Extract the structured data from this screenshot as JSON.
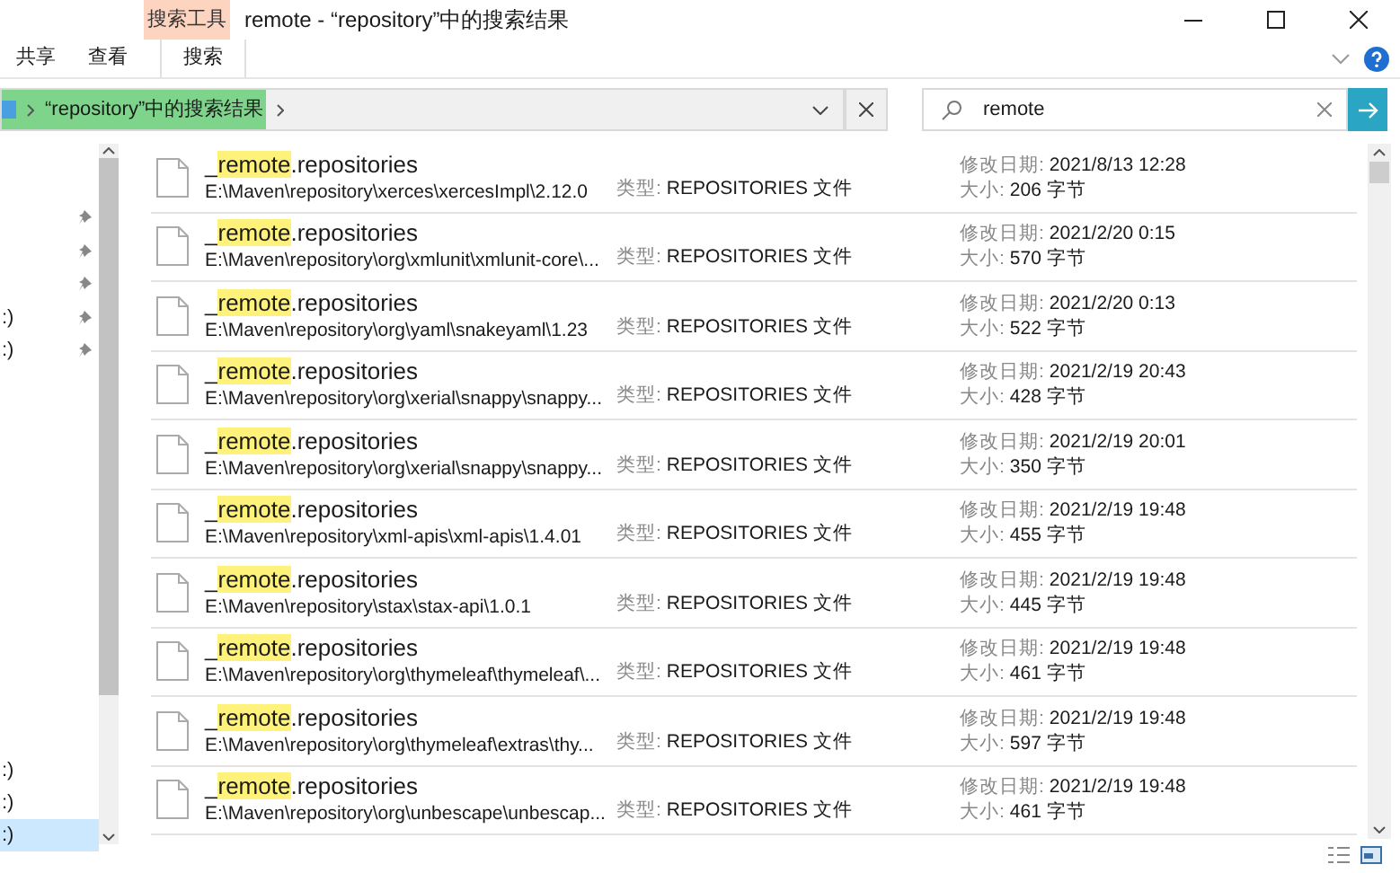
{
  "window": {
    "title": "remote - “repository”中的搜索结果"
  },
  "ribbon": {
    "context_label": "搜索工具",
    "tabs": [
      {
        "label": "共享",
        "selected": false
      },
      {
        "label": "查看",
        "selected": false
      },
      {
        "label": "搜索",
        "selected": true
      }
    ]
  },
  "address_bar": {
    "breadcrumb": "“repository”中的搜索结果"
  },
  "search": {
    "value": "remote"
  },
  "sidebar": {
    "items": [
      {
        "pinned": true,
        "selected": false
      },
      {
        "pinned": true,
        "selected": false
      },
      {
        "pinned": true,
        "selected": false
      },
      {
        "label": ":)",
        "pinned": true,
        "selected": false
      },
      {
        "label": ":)",
        "pinned": true,
        "selected": false
      },
      {
        "label": ":)",
        "pinned": false,
        "selected": false
      },
      {
        "label": ":)",
        "pinned": false,
        "selected": false
      },
      {
        "label": ":)",
        "pinned": false,
        "selected": true
      }
    ]
  },
  "results": [
    {
      "name_before": "_",
      "name_match": "remote",
      "name_after": ".repositories",
      "path": "E:\\Maven\\repository\\xerces\\xercesImpl\\2.12.0",
      "type_label": "类型:",
      "type": "REPOSITORIES 文件",
      "date_label": "修改日期:",
      "date": "2021/8/13 12:28",
      "size_label": "大小:",
      "size": "206 字节"
    },
    {
      "name_before": "_",
      "name_match": "remote",
      "name_after": ".repositories",
      "path": "E:\\Maven\\repository\\org\\xmlunit\\xmlunit-core\\...",
      "type_label": "类型:",
      "type": "REPOSITORIES 文件",
      "date_label": "修改日期:",
      "date": "2021/2/20 0:15",
      "size_label": "大小:",
      "size": "570 字节"
    },
    {
      "name_before": "_",
      "name_match": "remote",
      "name_after": ".repositories",
      "path": "E:\\Maven\\repository\\org\\yaml\\snakeyaml\\1.23",
      "type_label": "类型:",
      "type": "REPOSITORIES 文件",
      "date_label": "修改日期:",
      "date": "2021/2/20 0:13",
      "size_label": "大小:",
      "size": "522 字节"
    },
    {
      "name_before": "_",
      "name_match": "remote",
      "name_after": ".repositories",
      "path": "E:\\Maven\\repository\\org\\xerial\\snappy\\snappy...",
      "type_label": "类型:",
      "type": "REPOSITORIES 文件",
      "date_label": "修改日期:",
      "date": "2021/2/19 20:43",
      "size_label": "大小:",
      "size": "428 字节"
    },
    {
      "name_before": "_",
      "name_match": "remote",
      "name_after": ".repositories",
      "path": "E:\\Maven\\repository\\org\\xerial\\snappy\\snappy...",
      "type_label": "类型:",
      "type": "REPOSITORIES 文件",
      "date_label": "修改日期:",
      "date": "2021/2/19 20:01",
      "size_label": "大小:",
      "size": "350 字节"
    },
    {
      "name_before": "_",
      "name_match": "remote",
      "name_after": ".repositories",
      "path": "E:\\Maven\\repository\\xml-apis\\xml-apis\\1.4.01",
      "type_label": "类型:",
      "type": "REPOSITORIES 文件",
      "date_label": "修改日期:",
      "date": "2021/2/19 19:48",
      "size_label": "大小:",
      "size": "455 字节"
    },
    {
      "name_before": "_",
      "name_match": "remote",
      "name_after": ".repositories",
      "path": "E:\\Maven\\repository\\stax\\stax-api\\1.0.1",
      "type_label": "类型:",
      "type": "REPOSITORIES 文件",
      "date_label": "修改日期:",
      "date": "2021/2/19 19:48",
      "size_label": "大小:",
      "size": "445 字节"
    },
    {
      "name_before": "_",
      "name_match": "remote",
      "name_after": ".repositories",
      "path": "E:\\Maven\\repository\\org\\thymeleaf\\thymeleaf\\...",
      "type_label": "类型:",
      "type": "REPOSITORIES 文件",
      "date_label": "修改日期:",
      "date": "2021/2/19 19:48",
      "size_label": "大小:",
      "size": "461 字节"
    },
    {
      "name_before": "_",
      "name_match": "remote",
      "name_after": ".repositories",
      "path": "E:\\Maven\\repository\\org\\thymeleaf\\extras\\thy...",
      "type_label": "类型:",
      "type": "REPOSITORIES 文件",
      "date_label": "修改日期:",
      "date": "2021/2/19 19:48",
      "size_label": "大小:",
      "size": "597 字节"
    },
    {
      "name_before": "_",
      "name_match": "remote",
      "name_after": ".repositories",
      "path": "E:\\Maven\\repository\\org\\unbescape\\unbescap...",
      "type_label": "类型:",
      "type": "REPOSITORIES 文件",
      "date_label": "修改日期:",
      "date": "2021/2/19 19:48",
      "size_label": "大小:",
      "size": "461 字节"
    }
  ]
}
